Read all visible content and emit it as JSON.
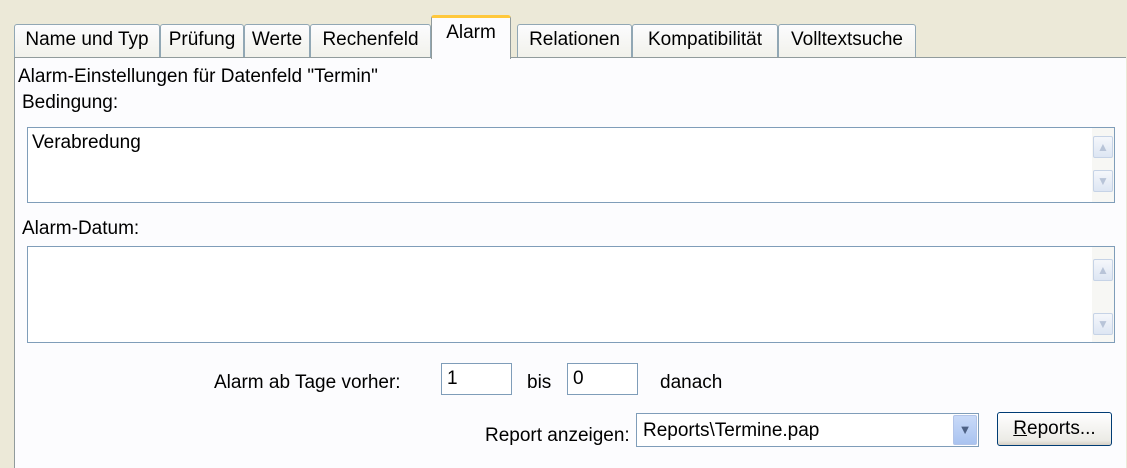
{
  "tabs": [
    {
      "label": "Name und Typ"
    },
    {
      "label": "Prüfung"
    },
    {
      "label": "Werte"
    },
    {
      "label": "Rechenfeld"
    },
    {
      "label": "Alarm",
      "active": true
    },
    {
      "label": "Relationen"
    },
    {
      "label": "Kompatibilität"
    },
    {
      "label": "Volltextsuche"
    }
  ],
  "panel": {
    "heading": "Alarm-Einstellungen für Datenfeld \"Termin\"",
    "condition": {
      "label": "Bedingung:",
      "value": "Verabredung"
    },
    "alarm_date": {
      "label": "Alarm-Datum:",
      "value": ""
    },
    "days": {
      "label_before": "Alarm ab Tage vorher:",
      "before_value": "1",
      "label_bis": "bis",
      "after_value": "0",
      "label_after": "danach"
    },
    "report": {
      "label": "Report anzeigen:",
      "selected": "Reports\\Termine.pap",
      "button_mnemonic": "R",
      "button_rest": "eports..."
    }
  },
  "icons": {
    "scroll_up": "▲",
    "scroll_down": "▼",
    "dropdown": "▼"
  },
  "colors": {
    "active_tab_accent": "#ffc83c",
    "panel_bg": "#fcfcfe",
    "window_bg": "#ece9d8"
  }
}
